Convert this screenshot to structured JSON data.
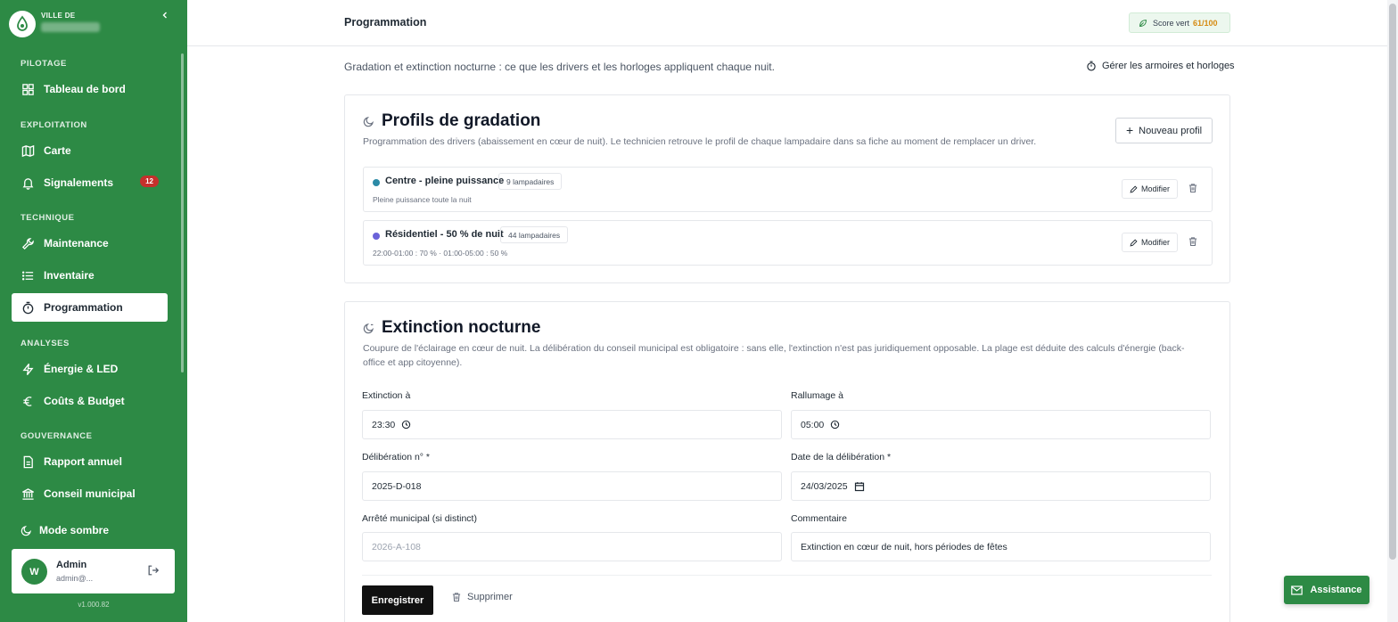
{
  "colors": {
    "brand": "#2d8a45",
    "badge": "#c5302c",
    "score": "#d68a11",
    "dot_centre": "#2b8aa6",
    "dot_residentiel": "#6b63d9"
  },
  "brand": {
    "small": "VILLE DE"
  },
  "sidebar": {
    "sections": {
      "pilotage": "PILOTAGE",
      "exploitation": "EXPLOITATION",
      "technique": "TECHNIQUE",
      "analyses": "ANALYSES",
      "gouvernance": "GOUVERNANCE"
    },
    "items": {
      "tableau": "Tableau de bord",
      "carte": "Carte",
      "signalements": "Signalements",
      "signalements_count": "12",
      "maintenance": "Maintenance",
      "inventaire": "Inventaire",
      "programmation": "Programmation",
      "energie": "Énergie & LED",
      "couts": "Coûts & Budget",
      "rapport": "Rapport annuel",
      "conseil": "Conseil municipal"
    },
    "dark_mode": "Mode sombre",
    "user": {
      "initial": "W",
      "name": "Admin",
      "email": "admin@..."
    },
    "version": "v1.000.82"
  },
  "header": {
    "title": "Programmation",
    "score_label": "Score vert",
    "score_value": "61/100"
  },
  "main": {
    "subtitle": "Gradation et extinction nocturne : ce que les drivers et les horloges appliquent chaque nuit.",
    "manage_link": "Gérer les armoires et horloges"
  },
  "gradation": {
    "title": "Profils de gradation",
    "description": "Programmation des drivers (abaissement en cœur de nuit). Le technicien retrouve le profil de chaque lampadaire dans sa fiche au moment de remplacer un driver.",
    "new_button": "Nouveau profil",
    "modify_label": "Modifier",
    "profiles": [
      {
        "name": "Centre - pleine puissance",
        "count": "9 lampadaires",
        "schedule": "Pleine puissance toute la nuit"
      },
      {
        "name": "Résidentiel - 50 % de nuit",
        "count": "44 lampadaires",
        "schedule": "22:00-01:00 : 70 % · 01:00-05:00 : 50 %"
      }
    ]
  },
  "extinction": {
    "title": "Extinction nocturne",
    "description_1": "Coupure de l'éclairage en cœur de nuit. La délibération du conseil municipal est obligatoire : sans elle, l'extinction n'est pas juridiquement opposable. La plage est déduite des calculs d'énergie (back-",
    "description_2": "office et app citoyenne).",
    "fields": {
      "extinction_label": "Extinction à",
      "extinction_value": "23:30",
      "rallumage_label": "Rallumage à",
      "rallumage_value": "05:00",
      "deliberation_label": "Délibération n° *",
      "deliberation_value": "2025-D-018",
      "date_label": "Date de la délibération *",
      "date_value": "24/03/2025",
      "arrete_label": "Arrêté municipal (si distinct)",
      "arrete_placeholder": "2026-A-108",
      "commentaire_label": "Commentaire",
      "commentaire_value": "Extinction en cœur de nuit, hors périodes de fêtes"
    },
    "save_button": "Enregistrer",
    "delete_button": "Supprimer"
  },
  "assistance": "Assistance"
}
